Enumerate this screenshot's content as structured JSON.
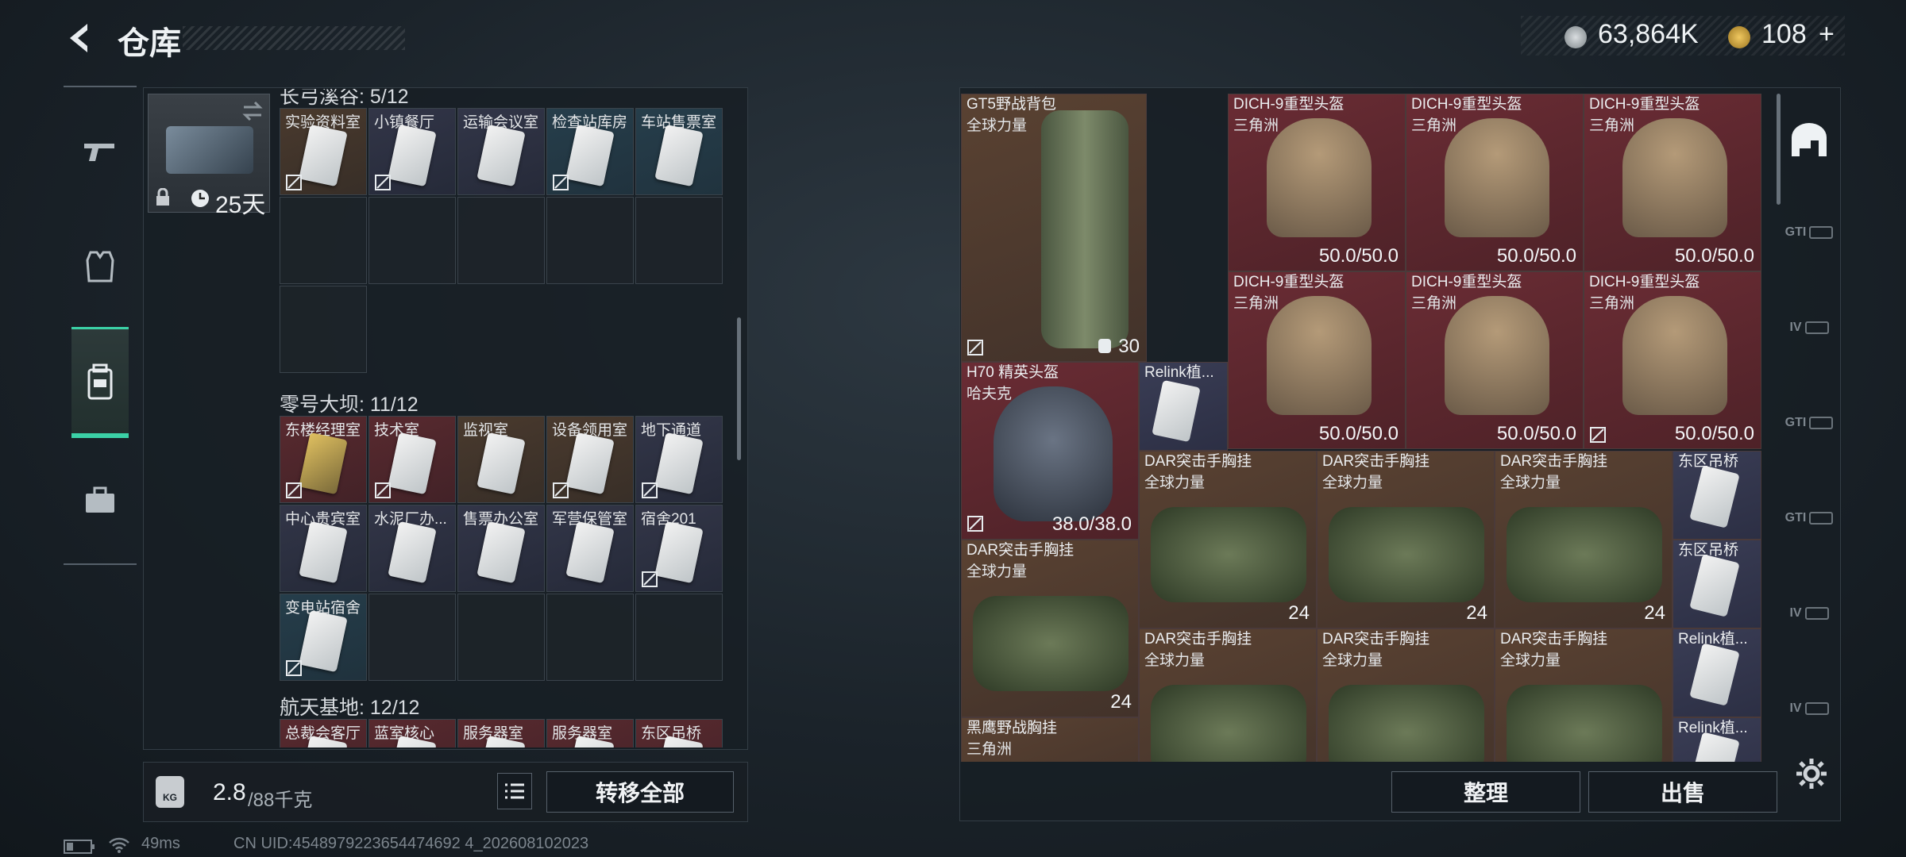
{
  "header": {
    "title": "仓库",
    "currency1_value": "63,864K",
    "currency2_value": "108",
    "currency2_plus": "+"
  },
  "nav": {
    "items": [
      {
        "name": "weapon-tab-icon"
      },
      {
        "name": "armor-tab-icon"
      },
      {
        "name": "storage-tab-icon",
        "active": true
      },
      {
        "name": "case-tab-icon"
      }
    ]
  },
  "key_slot": {
    "timer": "25天"
  },
  "sections": [
    {
      "title": "长弓溪谷: 5/12",
      "cells": [
        {
          "label": "实验资料室",
          "color": "brown",
          "locked": true
        },
        {
          "label": "小镇餐厅",
          "color": "filled",
          "locked": true
        },
        {
          "label": "运输会议室",
          "color": "filled",
          "locked": false
        },
        {
          "label": "检查站库房",
          "color": "blue",
          "locked": true
        },
        {
          "label": "车站售票室",
          "color": "blue",
          "locked": false
        }
      ]
    },
    {
      "title": "零号大坝: 11/12",
      "cells": [
        {
          "label": "东楼经理室",
          "color": "red",
          "locked": true,
          "gold": true
        },
        {
          "label": "技术室",
          "color": "red",
          "locked": true
        },
        {
          "label": "监视室",
          "color": "brown",
          "locked": false
        },
        {
          "label": "设备领用室",
          "color": "brown",
          "locked": true
        },
        {
          "label": "地下通道",
          "color": "filled",
          "locked": true
        },
        {
          "label": "中心贵宾室",
          "color": "filled",
          "locked": false
        },
        {
          "label": "水泥厂办...",
          "color": "filled",
          "locked": false
        },
        {
          "label": "售票办公室",
          "color": "filled",
          "locked": false
        },
        {
          "label": "军营保管室",
          "color": "filled",
          "locked": false
        },
        {
          "label": "宿舍201",
          "color": "filled",
          "locked": true
        },
        {
          "label": "变电站宿舍",
          "color": "blue",
          "locked": true
        }
      ]
    },
    {
      "title": "航天基地: 12/12",
      "cells": [
        {
          "label": "总裁会客厅",
          "color": "red"
        },
        {
          "label": "蓝室核心",
          "color": "red"
        },
        {
          "label": "服务器室",
          "color": "red"
        },
        {
          "label": "服务器室",
          "color": "red"
        },
        {
          "label": "东区吊桥",
          "color": "red"
        }
      ]
    }
  ],
  "bottom": {
    "weight_current": "2.8",
    "weight_max": "/88千克",
    "weight_unit_icon": "KG",
    "transfer_all": "转移全部"
  },
  "items": {
    "backpack": {
      "name": "GT5野战背包",
      "sub": "全球力量",
      "value": "30"
    },
    "helmets": [
      {
        "name": "DICH-9重型头盔",
        "sub": "三角洲",
        "value": "50.0/50.0"
      },
      {
        "name": "DICH-9重型头盔",
        "sub": "三角洲",
        "value": "50.0/50.0"
      },
      {
        "name": "DICH-9重型头盔",
        "sub": "三角洲",
        "value": "50.0/50.0"
      },
      {
        "name": "DICH-9重型头盔",
        "sub": "三角洲",
        "value": "50.0/50.0"
      },
      {
        "name": "DICH-9重型头盔",
        "sub": "三角洲",
        "value": "50.0/50.0"
      },
      {
        "name": "DICH-9重型头盔",
        "sub": "三角洲",
        "value": "50.0/50.0"
      }
    ],
    "h70": {
      "name": "H70 精英头盔",
      "sub": "哈夫克",
      "value": "38.0/38.0"
    },
    "relink1": {
      "name": "Relink植..."
    },
    "rigs": [
      {
        "name": "DAR突击手胸挂",
        "sub": "全球力量",
        "value": "24"
      },
      {
        "name": "DAR突击手胸挂",
        "sub": "全球力量",
        "value": "24"
      },
      {
        "name": "DAR突击手胸挂",
        "sub": "全球力量",
        "value": "24"
      },
      {
        "name": "DAR突击手胸挂",
        "sub": "全球力量",
        "value": "24"
      },
      {
        "name": "DAR突击手胸挂",
        "sub": "全球力量"
      },
      {
        "name": "DAR突击手胸挂",
        "sub": "全球力量"
      },
      {
        "name": "DAR突击手胸挂",
        "sub": "全球力量"
      }
    ],
    "keys_right": [
      {
        "name": "东区吊桥"
      },
      {
        "name": "东区吊桥"
      },
      {
        "name": "Relink植..."
      },
      {
        "name": "Relink植..."
      }
    ],
    "blackeagle": {
      "name": "黑鹰野战胸挂",
      "sub": "三角洲"
    }
  },
  "right_tabs": [
    "GTI",
    "IV",
    "GTI",
    "GTI",
    "IV",
    "IV"
  ],
  "actions": {
    "sort": "整理",
    "sell": "出售"
  },
  "status": {
    "ping": "49ms",
    "uid": "CN UID:4548979223654474692 4_202608102023"
  }
}
